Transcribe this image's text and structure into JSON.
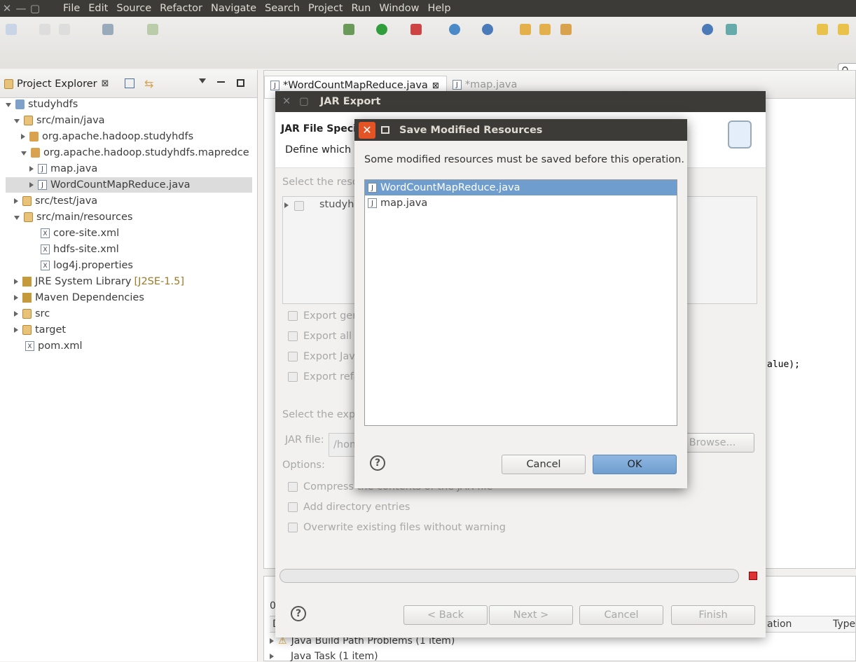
{
  "menubar": {
    "items": [
      "File",
      "Edit",
      "Source",
      "Refactor",
      "Navigate",
      "Search",
      "Project",
      "Run",
      "Window",
      "Help"
    ]
  },
  "project_explorer": {
    "title": "Project Explorer",
    "tree": [
      {
        "label": "studyhdfs",
        "extra": "",
        "expander": "down",
        "icon": "proj"
      },
      {
        "label": "src/main/java",
        "extra": "",
        "expander": "down",
        "icon": "fold"
      },
      {
        "label": "org.apache.hadoop.studyhdfs",
        "extra": "",
        "expander": "right",
        "icon": "pkg"
      },
      {
        "label": "org.apache.hadoop.studyhdfs.mapredce",
        "extra": "",
        "expander": "down",
        "icon": "pkg"
      },
      {
        "label": "map.java",
        "extra": "",
        "expander": "right",
        "icon": "java"
      },
      {
        "label": "WordCountMapReduce.java",
        "extra": "",
        "expander": "right",
        "icon": "java"
      },
      {
        "label": "src/test/java",
        "extra": "",
        "expander": "right",
        "icon": "fold"
      },
      {
        "label": "src/main/resources",
        "extra": "",
        "expander": "down",
        "icon": "fold"
      },
      {
        "label": "core-site.xml",
        "extra": "",
        "expander": "none",
        "icon": "xml"
      },
      {
        "label": "hdfs-site.xml",
        "extra": "",
        "expander": "none",
        "icon": "xml"
      },
      {
        "label": "log4j.properties",
        "extra": "",
        "expander": "none",
        "icon": "xml"
      },
      {
        "label": "JRE System Library",
        "extra": "[J2SE-1.5]",
        "expander": "right",
        "icon": "lib"
      },
      {
        "label": "Maven Dependencies",
        "extra": "",
        "expander": "right",
        "icon": "lib"
      },
      {
        "label": "src",
        "extra": "",
        "expander": "right",
        "icon": "fold"
      },
      {
        "label": "target",
        "extra": "",
        "expander": "right",
        "icon": "fold"
      },
      {
        "label": "pom.xml",
        "extra": "",
        "expander": "none",
        "icon": "xml"
      }
    ]
  },
  "editor": {
    "tabs": [
      "*WordCountMapReduce.java",
      "*map.java"
    ],
    "code_fragment": "alue);"
  },
  "bottom_panel": {
    "row0": "0",
    "col_d": "D",
    "col_location": "ation",
    "col_type": "Type",
    "rows": [
      "Java Build Path Problems (1 item)",
      "Java Task (1 item)"
    ]
  },
  "jar_export": {
    "title": "JAR Export",
    "banner_title": "JAR File Specific",
    "banner_desc": "Define which r",
    "select_resources": "Select the resou",
    "tree_item": "studyhc",
    "checks": [
      "Export gen",
      "Export all c",
      "Export Jav",
      "Export refa"
    ],
    "select_export": "Select the expo",
    "jar_file_label": "JAR file:",
    "jar_file_value": "/hom",
    "browse": "Browse...",
    "options_label": "Options:",
    "options": [
      "Compress the contents of the JAR file",
      "Add directory entries",
      "Overwrite existing files without warning"
    ],
    "buttons": {
      "back": "< Back",
      "next": "Next >",
      "cancel": "Cancel",
      "finish": "Finish"
    }
  },
  "save_dialog": {
    "title": "Save Modified Resources",
    "message": "Some modified resources must be saved before this operation.",
    "files": [
      "WordCountMapReduce.java",
      "map.java"
    ],
    "cancel": "Cancel",
    "ok": "OK"
  },
  "colors": {
    "title_bar": "#3c3b37",
    "close_orange": "#e25426",
    "selection": "#6f9ece",
    "ok_button": "#7ca7d8"
  }
}
